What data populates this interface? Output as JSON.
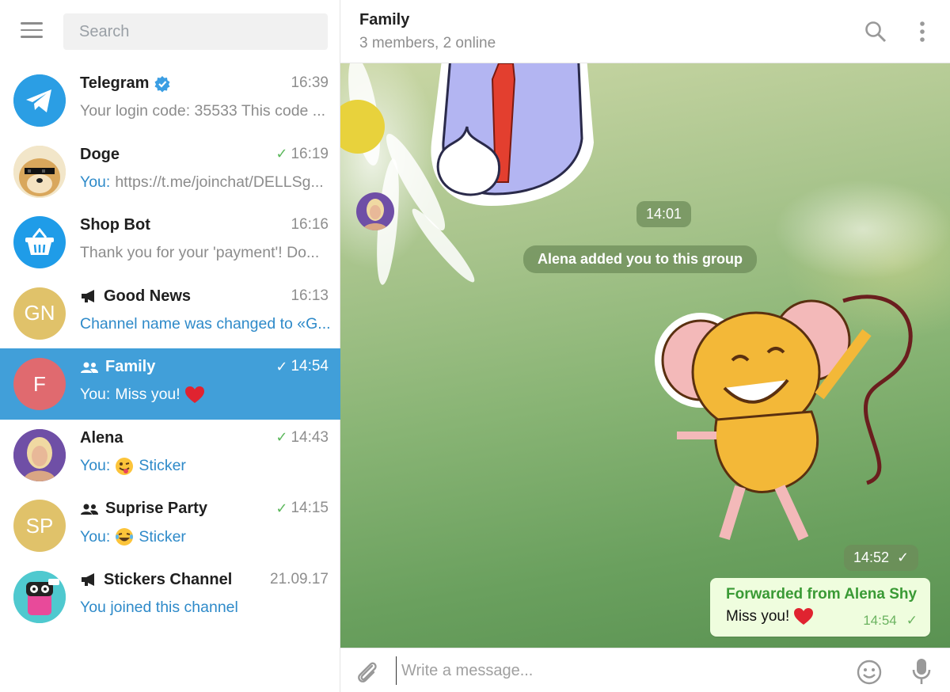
{
  "sidebar": {
    "search_placeholder": "Search",
    "chats": [
      {
        "name": "Telegram",
        "time": "16:39",
        "preview": "Your login code: 35533  This code ...",
        "verified": true,
        "avatar": "telegram-logo"
      },
      {
        "name": "Doge",
        "time": "16:19",
        "sent_check": true,
        "prefix": "You:",
        "preview": "https://t.me/joinchat/DELLSg...",
        "avatar": "doge-photo"
      },
      {
        "name": "Shop Bot",
        "time": "16:16",
        "preview": "Thank you for your 'payment'! Do...",
        "avatar": "shopping-basket-icon"
      },
      {
        "name": "Good News",
        "time": "16:13",
        "type_icon": "megaphone-icon",
        "preview": "Channel name was changed to «G...",
        "initials": "GN",
        "avatar_color": "#e0c26a"
      },
      {
        "name": "Family",
        "time": "14:54",
        "sent_check": true,
        "type_icon": "group-icon",
        "prefix": "You:",
        "preview": "Miss you!",
        "emoji": "heart-emoji",
        "initials": "F",
        "avatar_color": "#e06a6f",
        "active": true
      },
      {
        "name": "Alena",
        "time": "14:43",
        "sent_check": true,
        "prefix": "You:",
        "preview": "Sticker",
        "emoji": "winking-tongue-emoji",
        "avatar": "alena-photo"
      },
      {
        "name": "Suprise Party",
        "time": "14:15",
        "sent_check": true,
        "type_icon": "group-icon",
        "prefix": "You:",
        "preview": "Sticker",
        "emoji": "tears-of-joy-emoji",
        "initials": "SP",
        "avatar_color": "#e0c26a"
      },
      {
        "name": "Stickers Channel",
        "time": "21.09.17",
        "type_icon": "megaphone-icon",
        "preview": "You joined this channel",
        "avatar": "sticker-robot-avatar"
      }
    ]
  },
  "header": {
    "title": "Family",
    "subtitle": "3 members, 2 online"
  },
  "messages": {
    "time_pill_1": "14:01",
    "service": "Alena added you to this group",
    "time_pill_2": "14:52",
    "forwarded_label": "Forwarded from Alena Shy",
    "text": "Miss you!",
    "time": "14:54"
  },
  "composer": {
    "placeholder": "Write a message..."
  },
  "colors": {
    "accent": "#419fd9",
    "link": "#2e8ac9",
    "check": "#5cb85c",
    "bubble": "#effdde",
    "forward": "#3a9a35"
  }
}
